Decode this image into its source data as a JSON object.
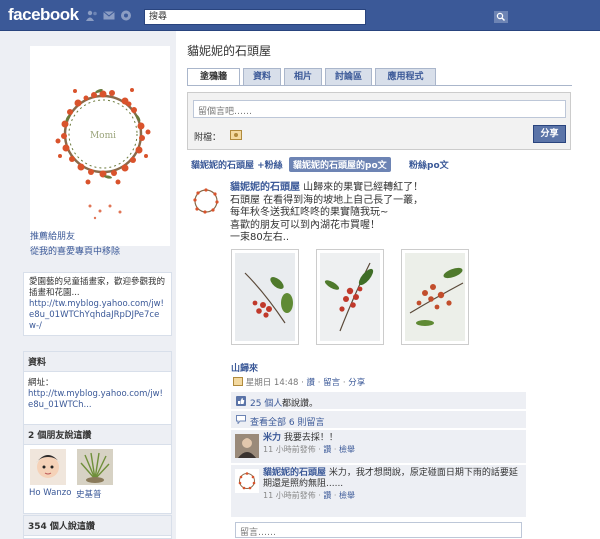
{
  "topbar": {
    "logo": "facebook",
    "search_value": "搜尋"
  },
  "left": {
    "profile_art_text": "Momi",
    "links": [
      "推薦給朋友",
      "從我的喜愛專頁中移除"
    ],
    "about": {
      "text": "愛園藝的兒童插畫家，歡迎參觀我的插畫和花園...",
      "url": "http://tw.myblog.yahoo.com/jw!e8u_01WTChYqhdaJRpDJPe7cew-/"
    },
    "info": {
      "header": "資料",
      "label": "網址：",
      "url": "http://tw.myblog.yahoo.com/jw!e8u_01WTCh..."
    },
    "friends": {
      "header": "2 個朋友說這讚",
      "names": [
        "Ho Wanzo",
        "史基普"
      ]
    },
    "likes_header": "354 個人說這讚"
  },
  "page": {
    "title": "貓妮妮的石頭屋",
    "tabs": [
      "塗鴉牆",
      "資料",
      "相片",
      "討論區",
      "應用程式"
    ],
    "active_tab": "塗鴉牆"
  },
  "composer": {
    "placeholder": "留個言吧……",
    "attach_label": "附檔：",
    "share_label": "分享"
  },
  "filters": [
    "貓妮妮的石頭屋 +粉絲",
    "貓妮妮的石頭屋的po文",
    "粉絲po文"
  ],
  "post": {
    "author": "貓妮妮的石頭屋",
    "lines": [
      " 山歸來的果實已經轉紅了！",
      "石頭屋 在看得到海的坡地上自己長了一叢，",
      "每年秋冬送我紅咚咚的果實隨我玩~",
      "喜歡的朋友可以到內湖花市買喔！",
      "一束80左右.."
    ],
    "link_title": "山歸來",
    "meta": {
      "time": "星期日 14:48",
      "like": "讚",
      "comment": "留言",
      "share": "分享",
      "sep": " · "
    },
    "likes_text": "25 個人",
    "likes_suffix": "都說讚。",
    "view_all": "查看全部 6 則留言"
  },
  "comments": [
    {
      "name": "米力",
      "text": " 我要去採！！",
      "time": "11 小時前發佈",
      "like": "讚",
      "delete": "檢舉"
    },
    {
      "name": "貓妮妮的石頭屋",
      "text": " 米力，我才想問說，原定碰面日期下雨的話要延期還是照約無阻......",
      "time": "11 小時前發佈",
      "like": "讚",
      "delete": "檢舉"
    }
  ],
  "comment_input_placeholder": "留言……",
  "colors": {
    "fb_blue": "#3b5998",
    "left_bg": "#edeff4",
    "berry": "#d9532c"
  }
}
